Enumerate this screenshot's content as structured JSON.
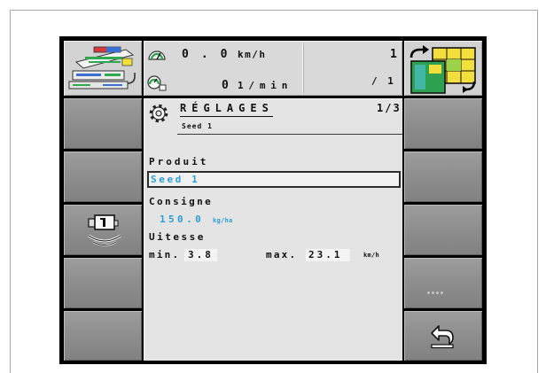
{
  "colors": {
    "accent_blue": "#2a9fd8",
    "panel_background": "#e4e4e4",
    "softkey_gray": "#8c8c8c",
    "frame_black": "#000000"
  },
  "status_bar": {
    "speed": {
      "icon": "speedometer-icon",
      "value": "0.0",
      "unit": "km/h"
    },
    "rpm": {
      "icon": "rpm-gauge-icon",
      "value": "0",
      "unit": "1/min"
    },
    "counter": {
      "current": "1",
      "total": "/ 1"
    }
  },
  "softkeys": {
    "left": [
      {
        "icon": "seeder-machine-icon"
      },
      {
        "icon": null
      },
      {
        "icon": null
      },
      {
        "icon": "calibration-test-icon"
      },
      {
        "icon": null
      },
      {
        "icon": null
      }
    ],
    "right": [
      {
        "icon": "section-control-icon"
      },
      {
        "icon": null
      },
      {
        "icon": null
      },
      {
        "icon": null
      },
      {
        "icon": "more-dots-icon"
      },
      {
        "icon": "return-icon"
      }
    ]
  },
  "header": {
    "icon": "settings-gear-icon",
    "title": "RÉGLAGES",
    "page_indicator": "1/3",
    "subtitle": "Seed 1"
  },
  "form": {
    "product": {
      "label": "Produit",
      "value": "Seed 1"
    },
    "setpoint": {
      "label": "Consigne",
      "value": "150.0",
      "unit": "kg/ha"
    },
    "speed_range": {
      "label": "Uitesse",
      "min_label": "min.",
      "min_value": "3.8",
      "max_label": "max.",
      "max_value": "23.1",
      "unit": "km/h"
    }
  }
}
